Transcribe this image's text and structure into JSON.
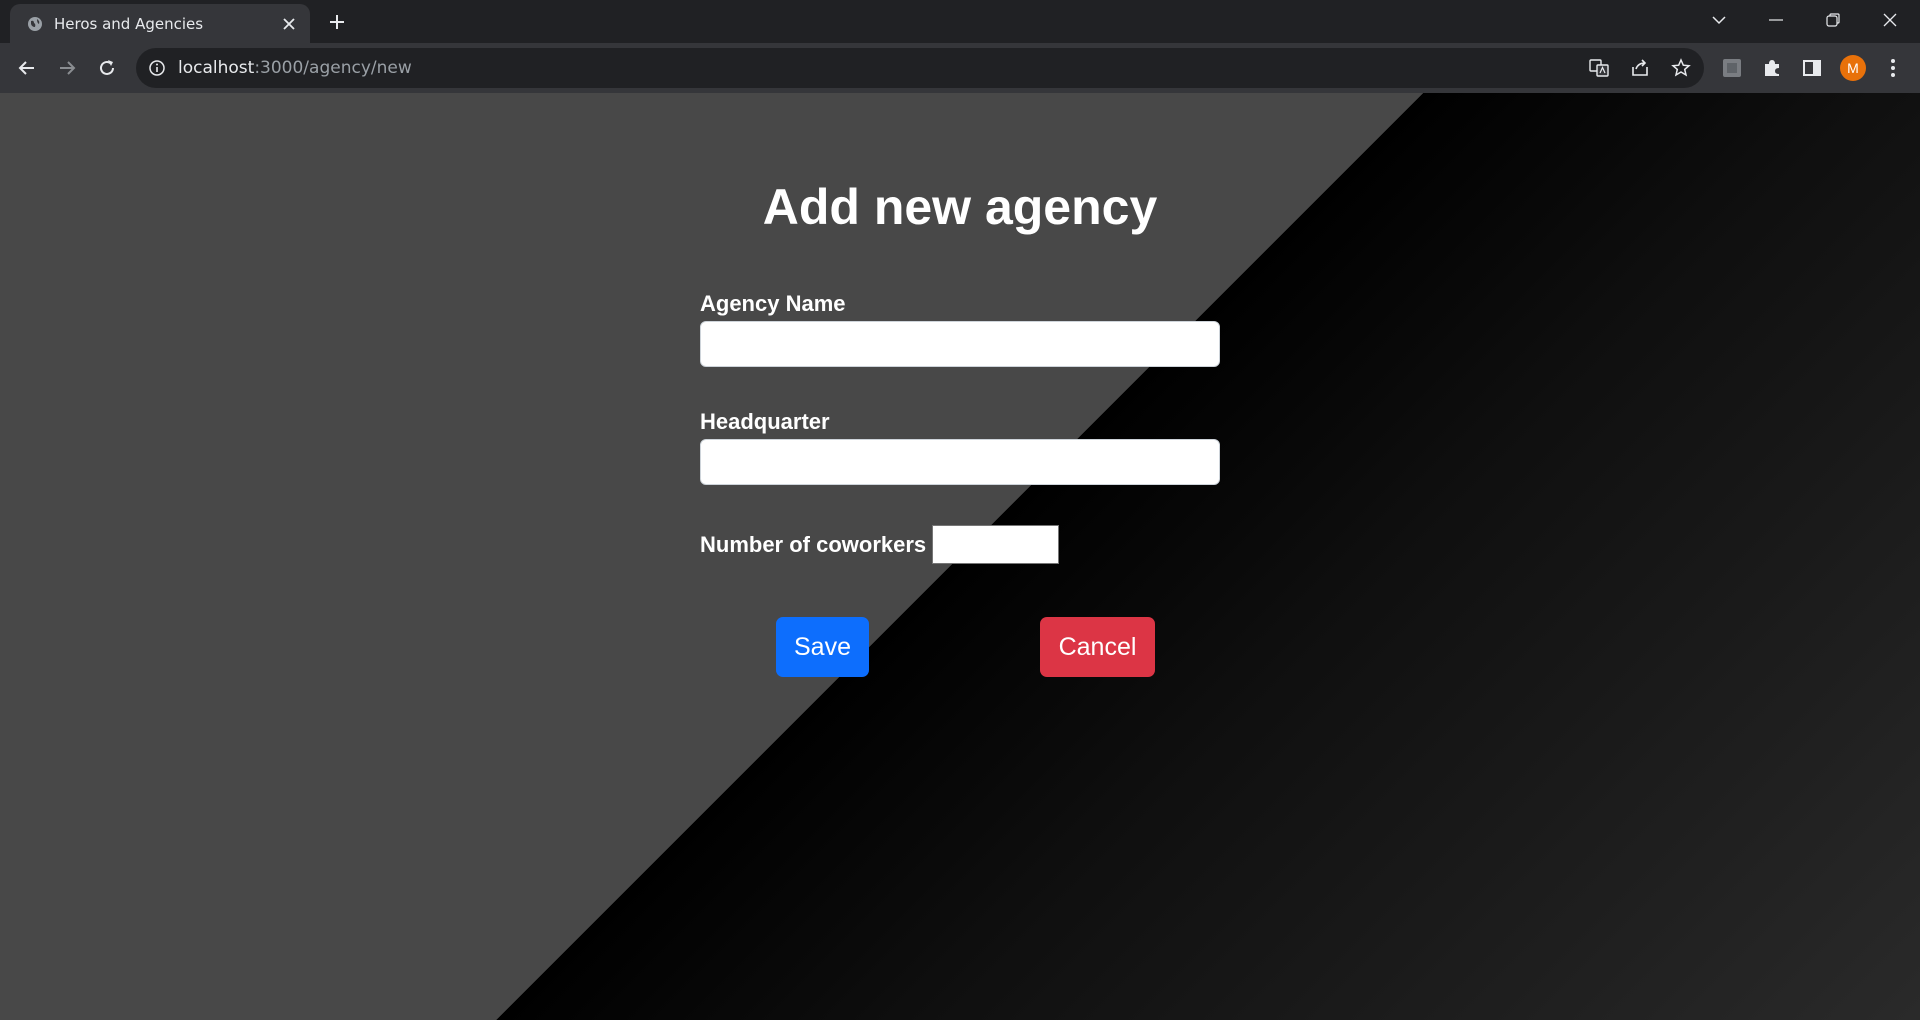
{
  "browser": {
    "tab": {
      "title": "Heros and Agencies"
    },
    "url": {
      "host": "localhost",
      "path": ":3000/agency/new"
    },
    "profile": {
      "initial": "M",
      "color": "#e8710a"
    }
  },
  "page": {
    "heading": "Add new agency",
    "fields": {
      "agency_name": {
        "label": "Agency Name",
        "value": ""
      },
      "headquarter": {
        "label": "Headquarter",
        "value": ""
      },
      "coworkers": {
        "label": "Number of coworkers",
        "value": ""
      }
    },
    "buttons": {
      "save": {
        "label": "Save",
        "color": "#0d6efd"
      },
      "cancel": {
        "label": "Cancel",
        "color": "#dc3545"
      }
    }
  }
}
